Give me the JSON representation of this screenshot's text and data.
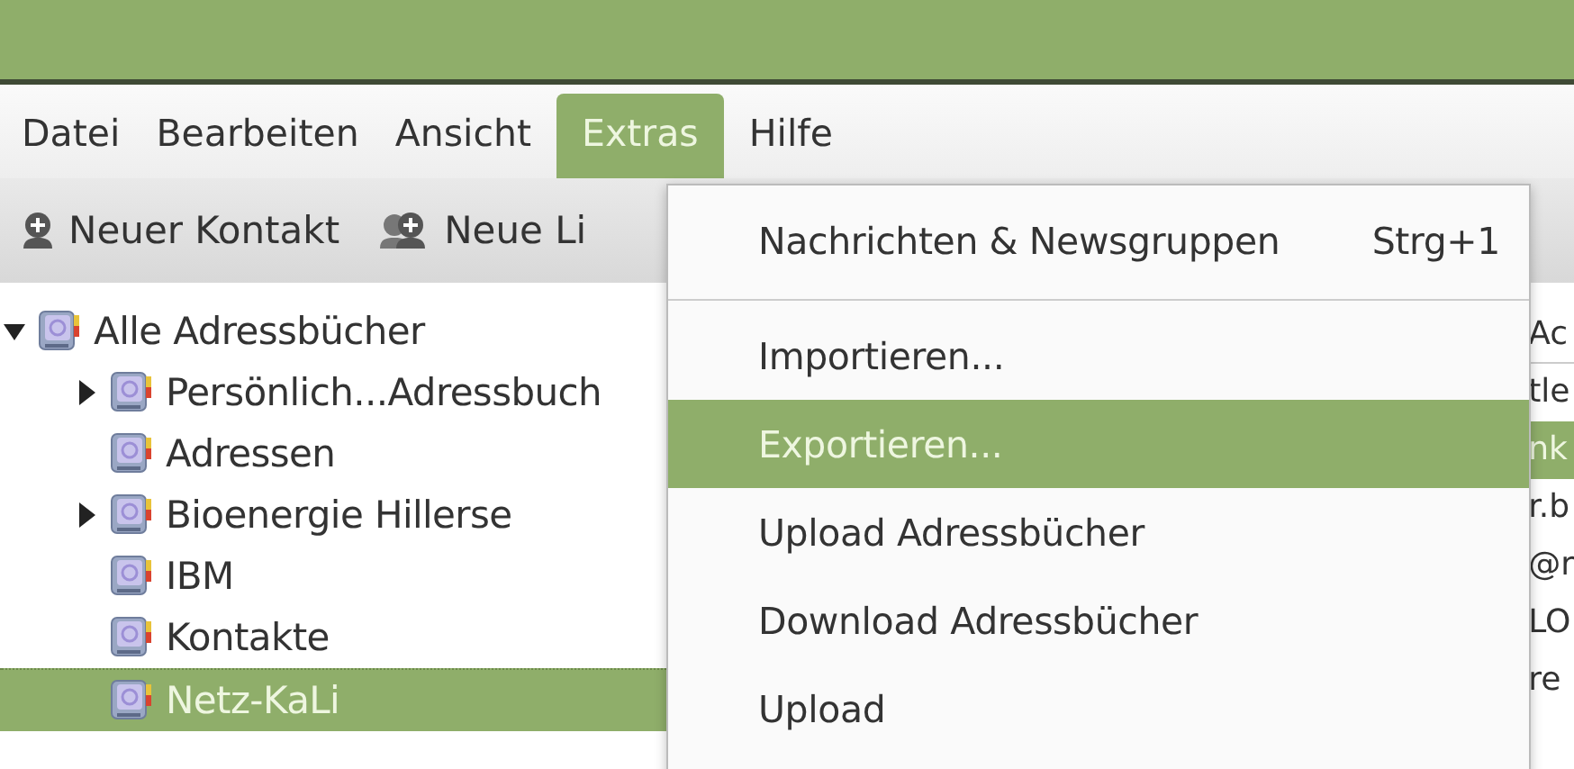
{
  "menubar": [
    {
      "label": "Datei",
      "selected": false
    },
    {
      "label": "Bearbeiten",
      "selected": false
    },
    {
      "label": "Ansicht",
      "selected": false
    },
    {
      "label": "Extras",
      "selected": true
    },
    {
      "label": "Hilfe",
      "selected": false
    }
  ],
  "toolbar": [
    {
      "label": "Neuer Kontakt",
      "kind": "contact"
    },
    {
      "label": "Neue Li",
      "kind": "list"
    }
  ],
  "tree": [
    {
      "label": "Alle Adressbücher",
      "expanded": true,
      "selected": false,
      "children": [
        {
          "label": "Persönlich...Adressbuch",
          "expanded": false,
          "selected": false
        },
        {
          "label": "Adressen",
          "selected": false
        },
        {
          "label": "Bioenergie Hillerse",
          "expanded": false,
          "selected": false
        },
        {
          "label": "IBM",
          "selected": false
        },
        {
          "label": "Kontakte",
          "selected": false
        },
        {
          "label": "Netz-KaLi",
          "selected": true
        }
      ]
    }
  ],
  "contact_list": {
    "column_1": "Ac",
    "rows": [
      {
        "text": "tle",
        "selected": false
      },
      {
        "text": "nk",
        "selected": true
      },
      {
        "text": "r.b",
        "selected": false
      },
      {
        "text": "@r",
        "selected": false
      },
      {
        "text": "LO",
        "selected": false
      },
      {
        "text": "re",
        "selected": false
      }
    ]
  },
  "menu": {
    "items": [
      {
        "kind": "item",
        "label": "Nachrichten & Newsgruppen",
        "shortcut": "Strg+1",
        "selected": false
      },
      {
        "kind": "separator"
      },
      {
        "kind": "item",
        "label": "Importieren...",
        "selected": false
      },
      {
        "kind": "item",
        "label": "Exportieren...",
        "selected": true
      },
      {
        "kind": "item",
        "label": "Upload Adressbücher",
        "selected": false
      },
      {
        "kind": "item",
        "label": "Download Adressbücher",
        "selected": false
      },
      {
        "kind": "item",
        "label": "Upload",
        "selected": false
      }
    ]
  }
}
